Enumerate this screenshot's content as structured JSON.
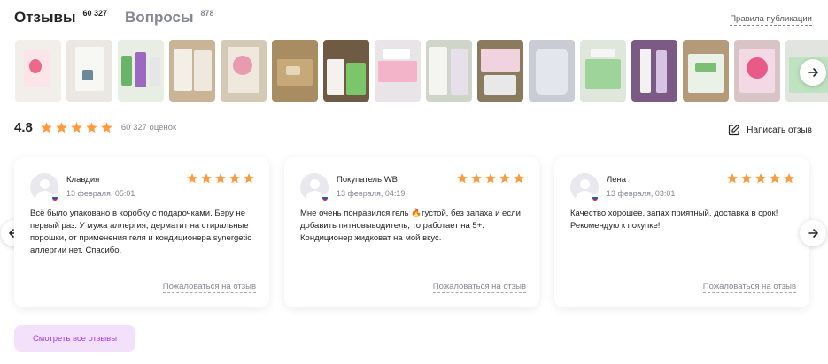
{
  "tabs": [
    {
      "label": "Отзывы",
      "count": "60 327"
    },
    {
      "label": "Вопросы",
      "count": "878"
    }
  ],
  "rules_link": "Правила публикации",
  "rating": {
    "value": "4.8",
    "stars": 5,
    "count_label": "60 327 оценок",
    "star_color": "#ff9a3c"
  },
  "write_review": "Написать отзыв",
  "reviews": [
    {
      "name": "Клавдия",
      "date": "13 февраля, 05:01",
      "stars": 5,
      "text": "Всё было упаковано в коробку с подарочками. Беру не первый раз. У мужа аллергия, дерматит на стиральные порошки, от применения геля и кондиционера synergetic аллергии нет. Спасибо.",
      "complain": "Пожаловаться на отзыв"
    },
    {
      "name": "Покупатель WB",
      "date": "13 февраля, 04:19",
      "stars": 5,
      "text": "Мне очень понравился гель 🔥густой, без запаха и если добавить пятновыводитель, то работает на 5+. Кондиционер жидковат на мой вкус.",
      "complain": "Пожаловаться на отзыв"
    },
    {
      "name": "Лена",
      "date": "13 февраля, 03:01",
      "stars": 5,
      "text": "Качество хорошее, запах приятный, доставка в срок! Рекомендую к покупке!",
      "complain": "Пожаловаться на отзыв"
    }
  ],
  "see_all": "Смотреть все отзывы",
  "colors": {
    "accent": "#a73afd",
    "accent_bg": "#f3e0fb",
    "muted": "#868695"
  }
}
